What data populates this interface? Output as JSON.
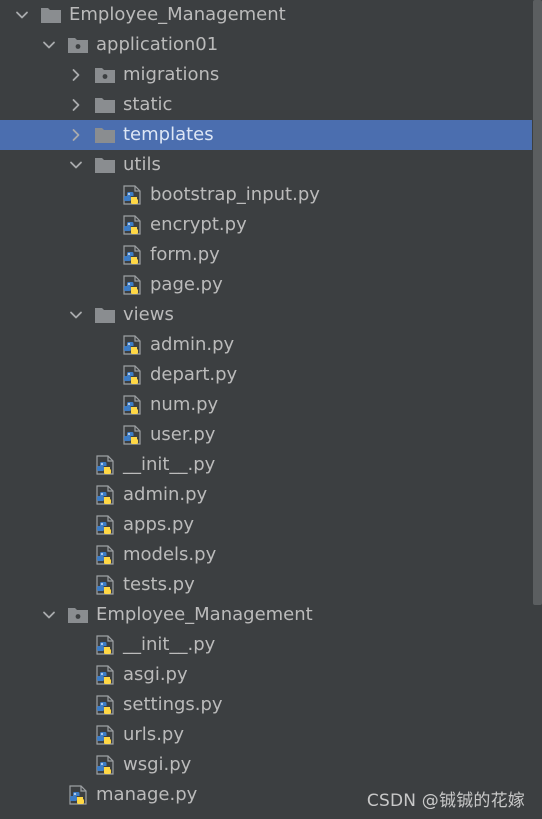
{
  "colors": {
    "background": "#3c3f41",
    "selection": "#4b6eaf",
    "text": "#bbbbbb",
    "folder_icon": "#8a8d90",
    "python_blue": "#3d7dc6",
    "python_yellow": "#ffd845"
  },
  "tree": [
    {
      "label": "Employee_Management",
      "depth": 0,
      "expander": "expanded",
      "icon": "folder-icon",
      "selected": false
    },
    {
      "label": "application01",
      "depth": 1,
      "expander": "expanded",
      "icon": "package-folder-icon",
      "selected": false
    },
    {
      "label": "migrations",
      "depth": 2,
      "expander": "collapsed",
      "icon": "package-folder-icon",
      "selected": false
    },
    {
      "label": "static",
      "depth": 2,
      "expander": "collapsed",
      "icon": "folder-icon",
      "selected": false
    },
    {
      "label": "templates",
      "depth": 2,
      "expander": "collapsed",
      "icon": "folder-icon",
      "selected": true
    },
    {
      "label": "utils",
      "depth": 2,
      "expander": "expanded",
      "icon": "folder-icon",
      "selected": false
    },
    {
      "label": "bootstrap_input.py",
      "depth": 3,
      "expander": "none",
      "icon": "python-file-icon",
      "selected": false
    },
    {
      "label": "encrypt.py",
      "depth": 3,
      "expander": "none",
      "icon": "python-file-icon",
      "selected": false
    },
    {
      "label": "form.py",
      "depth": 3,
      "expander": "none",
      "icon": "python-file-icon",
      "selected": false
    },
    {
      "label": "page.py",
      "depth": 3,
      "expander": "none",
      "icon": "python-file-icon",
      "selected": false
    },
    {
      "label": "views",
      "depth": 2,
      "expander": "expanded",
      "icon": "folder-icon",
      "selected": false
    },
    {
      "label": "admin.py",
      "depth": 3,
      "expander": "none",
      "icon": "python-file-icon",
      "selected": false
    },
    {
      "label": "depart.py",
      "depth": 3,
      "expander": "none",
      "icon": "python-file-icon",
      "selected": false
    },
    {
      "label": "num.py",
      "depth": 3,
      "expander": "none",
      "icon": "python-file-icon",
      "selected": false
    },
    {
      "label": "user.py",
      "depth": 3,
      "expander": "none",
      "icon": "python-file-icon",
      "selected": false
    },
    {
      "label": "__init__.py",
      "depth": 2,
      "expander": "none",
      "icon": "python-file-icon",
      "selected": false
    },
    {
      "label": "admin.py",
      "depth": 2,
      "expander": "none",
      "icon": "python-file-icon",
      "selected": false
    },
    {
      "label": "apps.py",
      "depth": 2,
      "expander": "none",
      "icon": "python-file-icon",
      "selected": false
    },
    {
      "label": "models.py",
      "depth": 2,
      "expander": "none",
      "icon": "python-file-icon",
      "selected": false
    },
    {
      "label": "tests.py",
      "depth": 2,
      "expander": "none",
      "icon": "python-file-icon",
      "selected": false
    },
    {
      "label": "Employee_Management",
      "depth": 1,
      "expander": "expanded",
      "icon": "package-folder-icon",
      "selected": false
    },
    {
      "label": "__init__.py",
      "depth": 2,
      "expander": "none",
      "icon": "python-file-icon",
      "selected": false
    },
    {
      "label": "asgi.py",
      "depth": 2,
      "expander": "none",
      "icon": "python-file-icon",
      "selected": false
    },
    {
      "label": "settings.py",
      "depth": 2,
      "expander": "none",
      "icon": "python-file-icon",
      "selected": false
    },
    {
      "label": "urls.py",
      "depth": 2,
      "expander": "none",
      "icon": "python-file-icon",
      "selected": false
    },
    {
      "label": "wsgi.py",
      "depth": 2,
      "expander": "none",
      "icon": "python-file-icon",
      "selected": false
    },
    {
      "label": "manage.py",
      "depth": 1,
      "expander": "none",
      "icon": "python-file-icon",
      "selected": false
    }
  ],
  "watermark": "CSDN @铖铖的花嫁"
}
